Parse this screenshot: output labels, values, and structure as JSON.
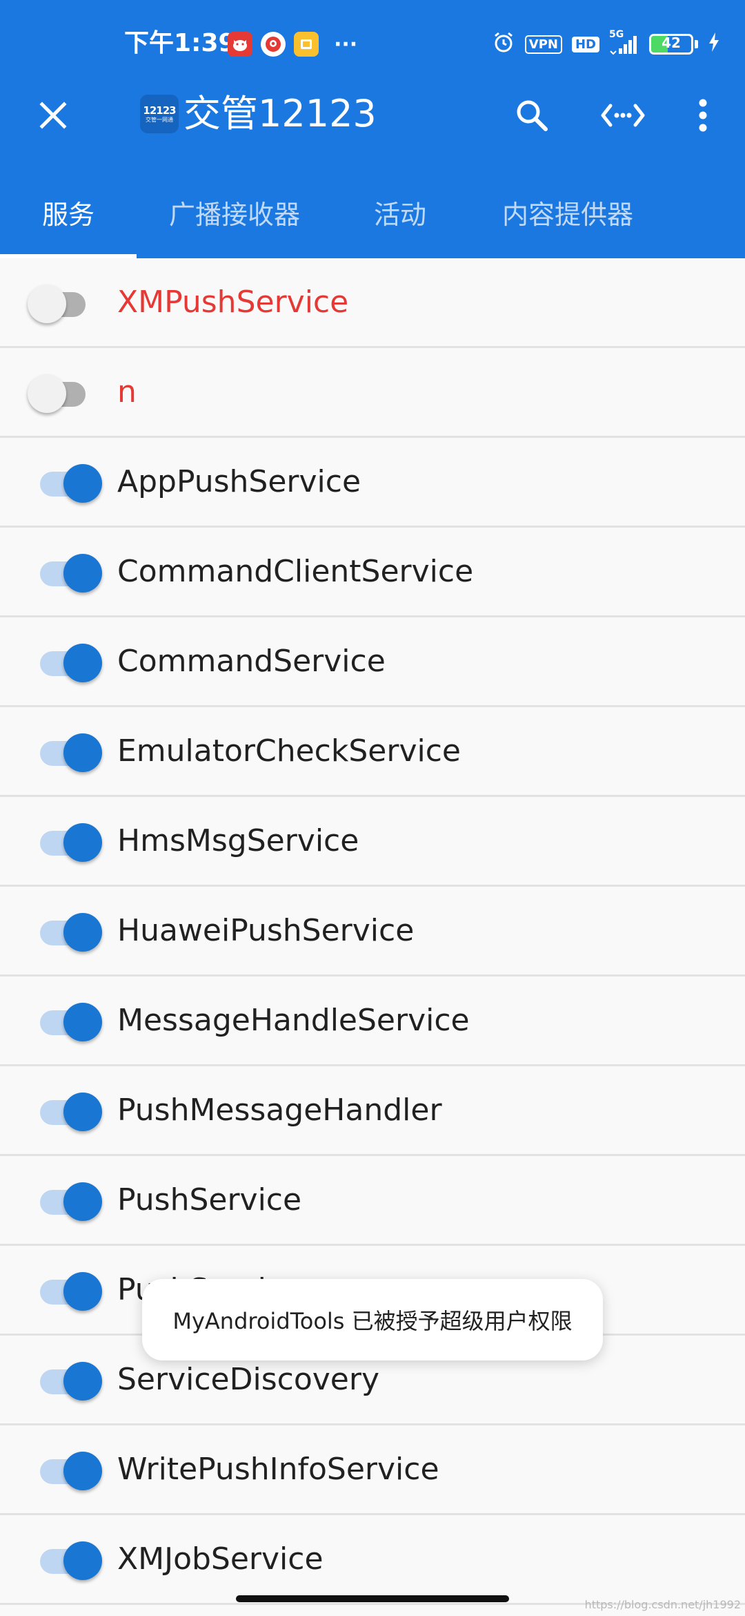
{
  "status_bar": {
    "time": "下午1:39",
    "more": "···",
    "vpn": "VPN",
    "hd": "HD",
    "network": "5G",
    "battery_level": 42,
    "battery_text": "42"
  },
  "app_bar": {
    "logo_number": "12123",
    "logo_caption": "交管一网通",
    "title": "交管12123"
  },
  "tabs": [
    {
      "label": "服务",
      "active": true
    },
    {
      "label": "广播接收器",
      "active": false
    },
    {
      "label": "活动",
      "active": false
    },
    {
      "label": "内容提供器",
      "active": false
    }
  ],
  "components": [
    {
      "name": "XMPushService",
      "enabled": false
    },
    {
      "name": "n",
      "enabled": false
    },
    {
      "name": "AppPushService",
      "enabled": true
    },
    {
      "name": "CommandClientService",
      "enabled": true
    },
    {
      "name": "CommandService",
      "enabled": true
    },
    {
      "name": "EmulatorCheckService",
      "enabled": true
    },
    {
      "name": "HmsMsgService",
      "enabled": true
    },
    {
      "name": "HuaweiPushService",
      "enabled": true
    },
    {
      "name": "MessageHandleService",
      "enabled": true
    },
    {
      "name": "PushMessageHandler",
      "enabled": true
    },
    {
      "name": "PushService",
      "enabled": true
    },
    {
      "name": "PushService",
      "enabled": true
    },
    {
      "name": "ServiceDiscovery",
      "enabled": true
    },
    {
      "name": "WritePushInfoService",
      "enabled": true
    },
    {
      "name": "XMJobService",
      "enabled": true
    }
  ],
  "toast": {
    "message": "MyAndroidTools 已被授予超级用户权限"
  },
  "watermark": "https://blog.csdn.net/jh1992",
  "colors": {
    "primary": "#1b78e0",
    "switch_on": "#1976d2",
    "disabled_text": "#e53935"
  }
}
